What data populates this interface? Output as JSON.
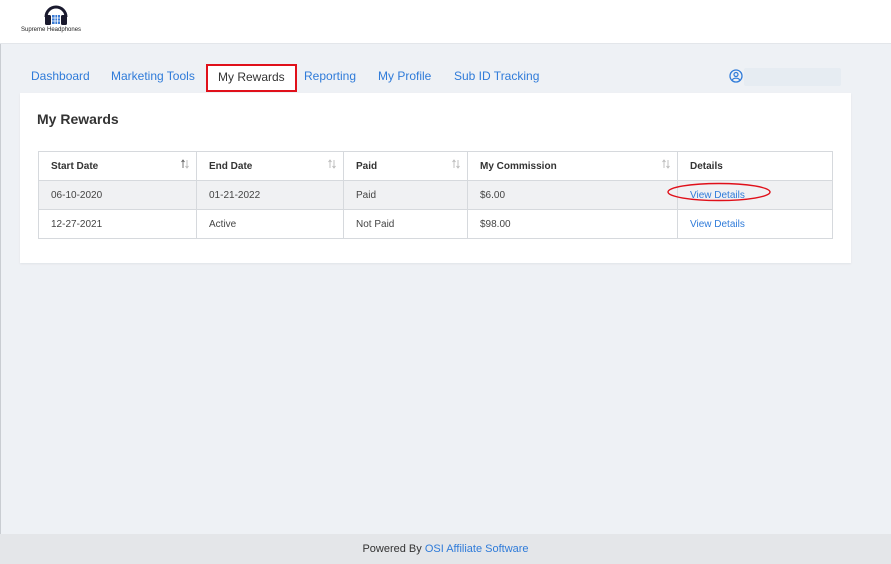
{
  "brand": {
    "logo_text": "Supreme Headphones"
  },
  "nav": {
    "tabs": [
      {
        "label": "Dashboard"
      },
      {
        "label": "Marketing Tools"
      },
      {
        "label": "My Rewards",
        "active": true
      },
      {
        "label": "Reporting"
      },
      {
        "label": "My Profile"
      },
      {
        "label": "Sub ID Tracking"
      }
    ]
  },
  "main": {
    "title": "My Rewards",
    "table": {
      "headers": [
        "Start Date",
        "End Date",
        "Paid",
        "My Commission",
        "Details"
      ],
      "rows": [
        {
          "start_date": "06-10-2020",
          "end_date": "01-21-2022",
          "paid": "Paid",
          "commission": "$6.00",
          "details": "View Details",
          "highlighted": true
        },
        {
          "start_date": "12-27-2021",
          "end_date": "Active",
          "paid": "Not Paid",
          "commission": "$98.00",
          "details": "View Details"
        }
      ]
    }
  },
  "footer": {
    "prefix": "Powered By",
    "link": "OSI Affiliate Software"
  },
  "colors": {
    "accent": "#2f7bd9",
    "highlight": "#e0101a",
    "background": "#eef1f5"
  },
  "icons": [
    "headphones-logo-icon",
    "user-circle-icon",
    "sort-icon"
  ]
}
